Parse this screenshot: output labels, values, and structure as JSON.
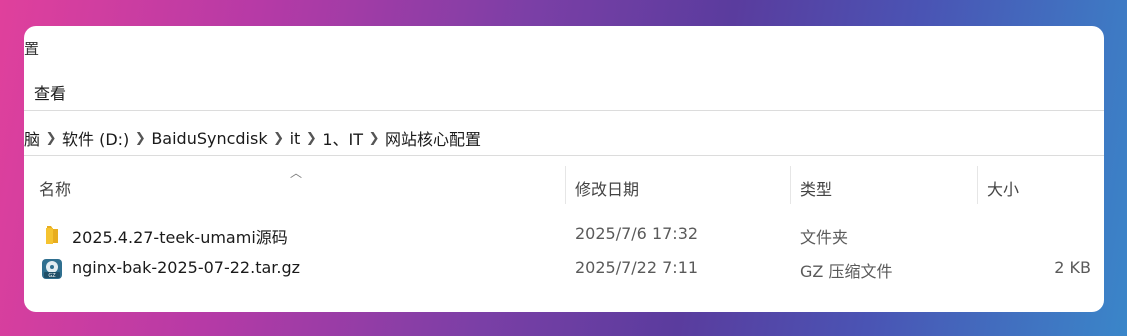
{
  "window": {
    "title_fragment": "置"
  },
  "menu": {
    "view_label": "查看"
  },
  "breadcrumb": [
    "脑",
    "软件 (D:)",
    "BaiduSyncdisk",
    "it",
    "1、IT",
    "网站核心配置"
  ],
  "columns": {
    "name": "名称",
    "modified": "修改日期",
    "type": "类型",
    "size": "大小"
  },
  "files": [
    {
      "icon": "folder-icon",
      "name": "2025.4.27-teek-umami源码",
      "modified": "2025/7/6 17:32",
      "type": "文件夹",
      "size": ""
    },
    {
      "icon": "gz-archive-icon",
      "name": "nginx-bak-2025-07-22.tar.gz",
      "modified": "2025/7/22 7:11",
      "type": "GZ 压缩文件",
      "size": "2 KB"
    }
  ],
  "colors": {
    "folder": "#f5c330",
    "archive": "#2f6f8f"
  }
}
